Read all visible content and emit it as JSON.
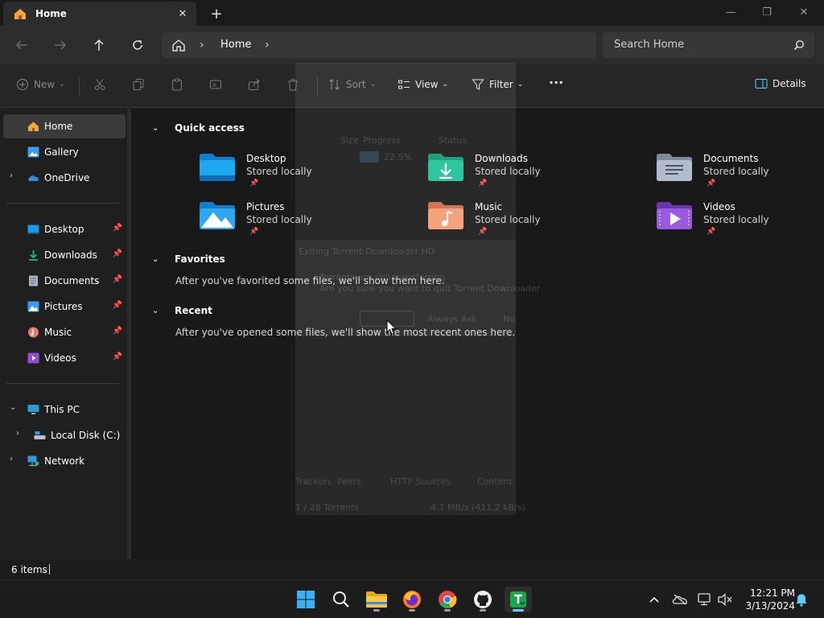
{
  "tab": {
    "title": "Home",
    "close_glyph": "✕",
    "new_tab_glyph": "+"
  },
  "window_controls": {
    "minimize": "—",
    "maximize": "❐",
    "close": "✕"
  },
  "address_bar": {
    "home_label": "Home",
    "separator": "›"
  },
  "search": {
    "placeholder": "Search Home"
  },
  "command_bar": {
    "new_label": "New",
    "sort_label": "Sort",
    "view_label": "View",
    "filter_label": "Filter",
    "more_label": "···",
    "details_label": "Details"
  },
  "sidebar": {
    "top": [
      {
        "label": "Home",
        "icon": "home-icon"
      },
      {
        "label": "Gallery",
        "icon": "gallery-icon"
      },
      {
        "label": "OneDrive",
        "icon": "onedrive-icon"
      }
    ],
    "pinned": [
      {
        "label": "Desktop",
        "icon": "desktop-icon"
      },
      {
        "label": "Downloads",
        "icon": "downloads-icon"
      },
      {
        "label": "Documents",
        "icon": "documents-icon"
      },
      {
        "label": "Pictures",
        "icon": "pictures-icon"
      },
      {
        "label": "Music",
        "icon": "music-icon"
      },
      {
        "label": "Videos",
        "icon": "videos-icon"
      }
    ],
    "devices": [
      {
        "label": "This PC",
        "icon": "pc-icon"
      },
      {
        "label": "Local Disk (C:)",
        "icon": "disk-icon"
      },
      {
        "label": "Network",
        "icon": "network-icon"
      }
    ]
  },
  "main": {
    "quick_access_title": "Quick access",
    "quick_access": [
      {
        "name": "Desktop",
        "status": "Stored locally",
        "icon": "desktop-folder-icon"
      },
      {
        "name": "Downloads",
        "status": "Stored locally",
        "icon": "downloads-folder-icon"
      },
      {
        "name": "Documents",
        "status": "Stored locally",
        "icon": "documents-folder-icon"
      },
      {
        "name": "Pictures",
        "status": "Stored locally",
        "icon": "pictures-folder-icon"
      },
      {
        "name": "Music",
        "status": "Stored locally",
        "icon": "music-folder-icon"
      },
      {
        "name": "Videos",
        "status": "Stored locally",
        "icon": "videos-folder-icon"
      }
    ],
    "favorites_title": "Favorites",
    "favorites_empty": "After you've favorited some files, we'll show them here.",
    "recent_title": "Recent",
    "recent_empty": "After you've opened some files, we'll show the most recent ones here."
  },
  "ghost_window": {
    "col_size": "Size",
    "col_progress": "Progress",
    "col_status": "Status",
    "progress_value": "22.5%",
    "dialog_title": "Exiting Torrent Downloader HD",
    "dialog_line1": "Torrents are still transferring.",
    "dialog_line2": "Are you sure you want to quit Torrent Downloader",
    "btn_always": "Always Ask",
    "btn_no": "No",
    "tab_peers": "Peers",
    "tab_sources": "HTTP Sources",
    "tab_content": "Content",
    "tab_trackers": "Trackers",
    "footer_torrents": "1 / 28 Torrents",
    "footer_speed": "4.1 MB/s (411.2 kB/s)"
  },
  "status_bar": {
    "count": "6 items"
  },
  "taskbar": {
    "time": "12:21 PM",
    "date": "3/13/2024",
    "apps": [
      "start-icon",
      "search-icon",
      "file-explorer-icon",
      "firefox-icon",
      "chrome-icon",
      "github-icon",
      "torrent-app-icon"
    ]
  },
  "colors": {
    "accent": "#60cdff",
    "folder_blue": "#1e9be8",
    "downloads_green": "#1db68e",
    "documents_gray": "#aab4c4",
    "music_orange": "#f08a5d",
    "videos_purple": "#8e4fd4"
  }
}
